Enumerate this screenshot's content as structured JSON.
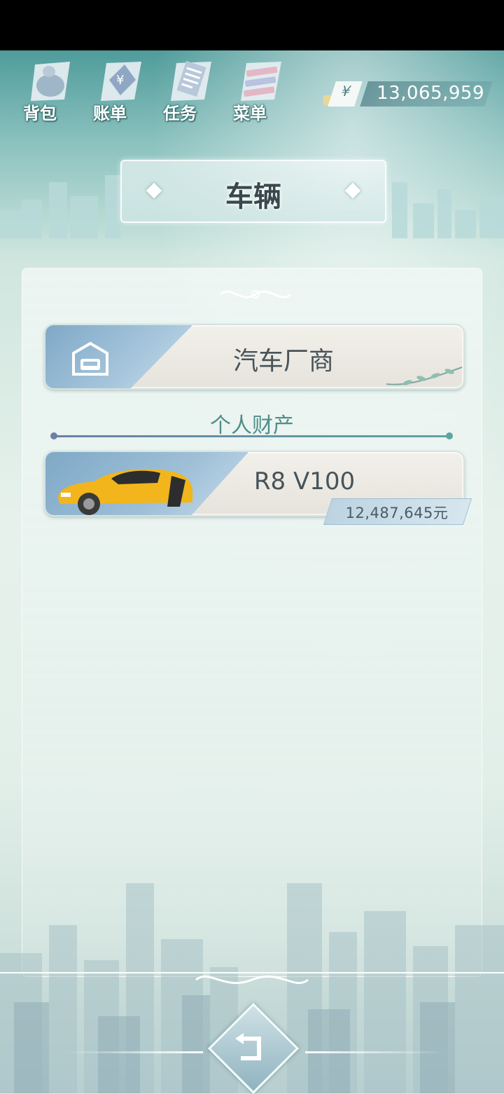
{
  "nav": {
    "items": [
      {
        "label": "背包",
        "icon": "bag-icon"
      },
      {
        "label": "账单",
        "icon": "bill-icon"
      },
      {
        "label": "任务",
        "icon": "task-icon"
      },
      {
        "label": "菜单",
        "icon": "menu-icon"
      }
    ]
  },
  "currency": {
    "symbol": "¥",
    "value": "13,065,959"
  },
  "page": {
    "title": "车辆"
  },
  "dealer": {
    "label": "汽车厂商",
    "icon": "garage-icon"
  },
  "section": {
    "label": "个人财产"
  },
  "vehicle": {
    "name": "R8 V100",
    "price": "12,487,645元",
    "icon": "yellow-sports-car-icon"
  },
  "back": {
    "icon": "return-arrow-icon"
  },
  "colors": {
    "accent": "#4f8e8a",
    "card": "#ece9e2",
    "car": "#f2b51b"
  }
}
